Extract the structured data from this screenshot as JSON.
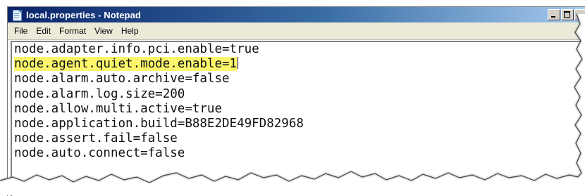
{
  "window": {
    "title": "local.properties - Notepad",
    "icon": "notepad-icon"
  },
  "menu": [
    "File",
    "Edit",
    "Format",
    "View",
    "Help"
  ],
  "editor": {
    "lines": [
      "node.adapter.info.pci.enable=true",
      "node.agent.quiet.mode.enable=1",
      "node.alarm.auto.archive=false",
      "node.alarm.log.size=200",
      "node.allow.multi.active=true",
      "node.application.build=B88E2DE49FD82968",
      "node.assert.fail=false",
      "node.auto.connect=false"
    ],
    "highlight_line": 1,
    "highlight_color": "#fbf66b"
  },
  "colors": {
    "titlebar_start": "#0a246a",
    "titlebar_end": "#a6caf0"
  }
}
